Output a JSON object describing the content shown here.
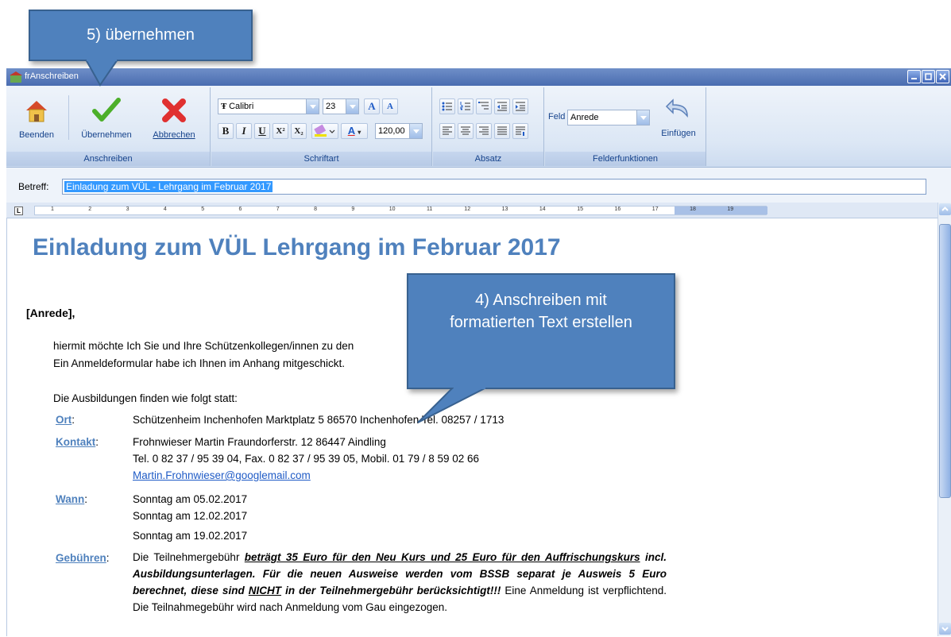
{
  "window": {
    "title": "frAnschreiben"
  },
  "ribbon": {
    "group_anschreiben": {
      "label": "Anschreiben",
      "beenden": "Beenden",
      "uebernehmen": "Übernehmen",
      "abbrechen": "Abbrechen"
    },
    "group_schriftart": {
      "label": "Schriftart",
      "font_name": "Calibri",
      "font_size": "23",
      "zoom": "120,00",
      "bold": "B",
      "italic": "I",
      "underline": "U",
      "superscript": "X²",
      "subscript": "X₂",
      "grow_font": "A",
      "shrink_font": "A",
      "font_color": "A"
    },
    "group_absatz": {
      "label": "Absatz"
    },
    "group_felder": {
      "label": "Felderfunktionen",
      "field_label": "Feld",
      "field_value": "Anrede",
      "insert": "Einfügen"
    }
  },
  "betreff": {
    "label": "Betreff:",
    "value": "Einladung zum VÜL - Lehrgang im Februar 2017"
  },
  "ruler": {
    "numbers": [
      "1",
      "2",
      "3",
      "4",
      "5",
      "6",
      "7",
      "8",
      "9",
      "10",
      "11",
      "12",
      "13",
      "14",
      "15",
      "16",
      "17",
      "18",
      "19"
    ]
  },
  "document": {
    "heading": "Einladung zum VÜL   Lehrgang im Februar 2017",
    "salutation": "[Anrede],",
    "intro_line1": "hiermit möchte Ich Sie und Ihre Schützenkollegen/innen zu den",
    "intro_line2": "Ein Anmeldeformular habe ich Ihnen im Anhang mitgeschickt.",
    "schedule_intro": "Die Ausbildungen finden wie folgt statt:",
    "ort_label": "Ort",
    "ort_value": "Schützenheim Inchenhofen   Marktplatz 5   86570 Inchenhofen   Tel. 08257 / 1713",
    "kontakt_label": "Kontakt",
    "kontakt_line1": "Frohnwieser Martin   Fraundorferstr. 12   86447 Aindling",
    "kontakt_line2": "Tel. 0 82 37 / 95 39 04, Fax. 0 82 37 / 95 39 05, Mobil. 01 79 / 8 59 02 66",
    "kontakt_email": "Martin.Frohnwieser@googlemail.com",
    "wann_label": "Wann",
    "wann_dates": [
      "Sonntag am 05.02.2017",
      "Sonntag am 12.02.2017",
      "Sonntag am 19.02.2017"
    ],
    "gebuehren_label": "Gebühren",
    "fees_plain1": "Die Teilnehmergebühr ",
    "fees_bold1": "beträgt 35 Euro für den Neu Kurs und 25 Euro für den Auffrischungskurs",
    "fees_bold2": " incl. Ausbildungsunterlagen. Für die neuen Ausweise werden vom BSSB separat je Ausweis 5 Euro berechnet, diese sind ",
    "fees_nicht": "NICHT",
    "fees_bold3": " in der Teilnehmergebühr berücksichtigt!!!",
    "fees_plain2": " Eine Anmeldung ist verpflichtend. Die Teilnahmegebühr wird nach Anmeldung vom Gau eingezogen."
  },
  "callouts": {
    "step5": "5) übernehmen",
    "step4": "4) Anschreiben mit formatierten Text erstellen"
  },
  "colors": {
    "accent": "#4f81bd",
    "ribbon_text": "#15428b",
    "selection": "#3399ff"
  }
}
